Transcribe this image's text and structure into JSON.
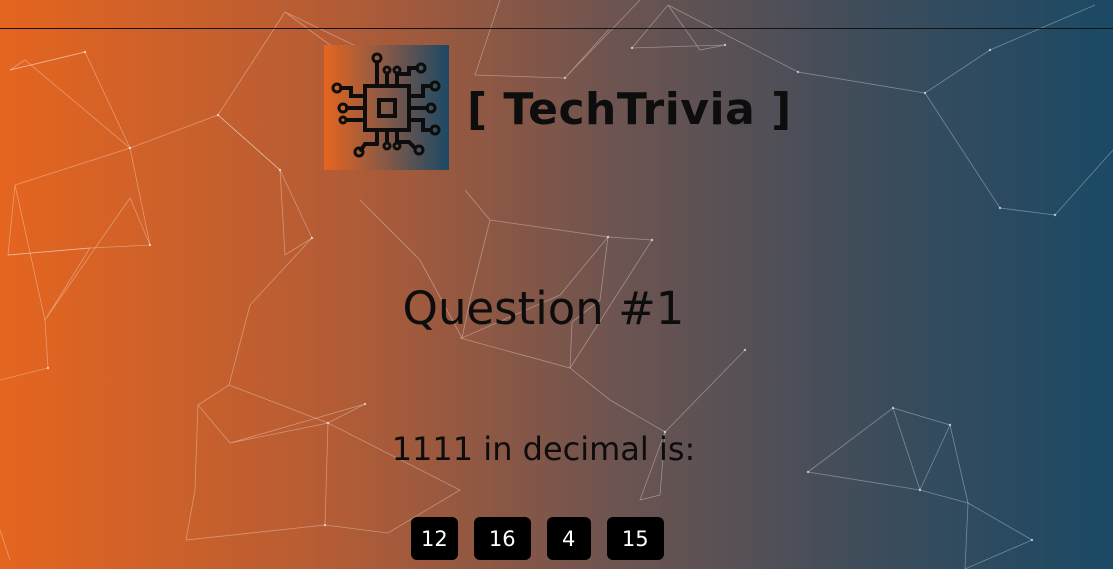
{
  "header": {
    "title": "[ TechTrivia ]",
    "logo_icon": "circuit-chip-icon"
  },
  "question": {
    "heading": "Question #1",
    "text": "1111 in decimal is:"
  },
  "answers": [
    {
      "label": "12"
    },
    {
      "label": "16"
    },
    {
      "label": "4"
    },
    {
      "label": "15"
    }
  ],
  "colors": {
    "gradient_left": "#e5651f",
    "gradient_right": "#1b4965",
    "button_bg": "#000000",
    "button_text": "#ffffff"
  }
}
